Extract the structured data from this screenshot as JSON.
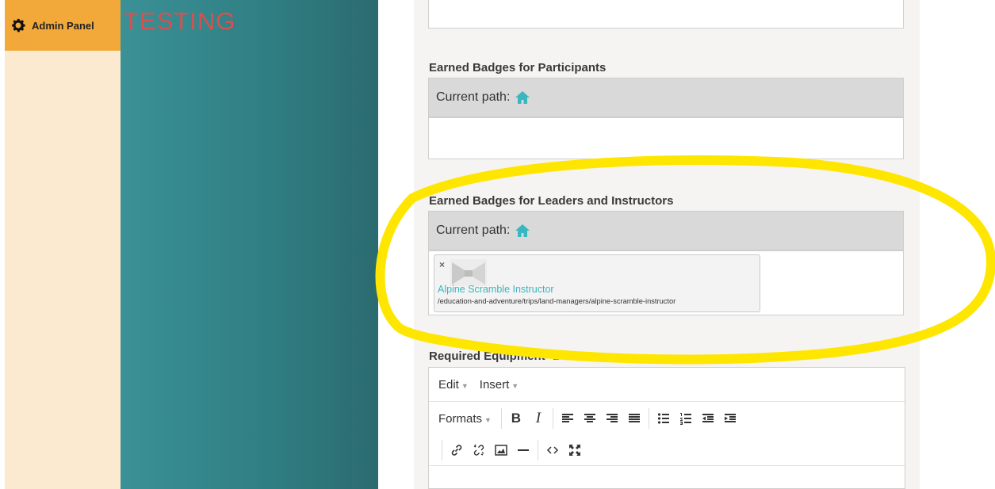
{
  "header": {
    "admin_label": "Admin Panel",
    "env_label": "TESTING"
  },
  "fields": {
    "participants": {
      "label": "Earned Badges for Participants",
      "path_label": "Current path:"
    },
    "leaders": {
      "label": "Earned Badges for Leaders and Instructors",
      "path_label": "Current path:",
      "selected": {
        "title": "Alpine Scramble Instructor",
        "path": "/education-and-adventure/trips/land-managers/alpine-scramble-instructor",
        "remove_glyph": "×"
      }
    },
    "equipment": {
      "label": "Required Equipment"
    }
  },
  "editor": {
    "menu": [
      "Edit",
      "Insert"
    ],
    "formats_label": "Formats",
    "bold_glyph": "B",
    "italic_glyph": "I"
  },
  "colors": {
    "accent": "#3ab6c0",
    "admin_bg": "#f2a93a",
    "teal": "#307f84",
    "testing": "#d8504f",
    "highlight": "#ffe600",
    "required": "#e23b3b"
  }
}
